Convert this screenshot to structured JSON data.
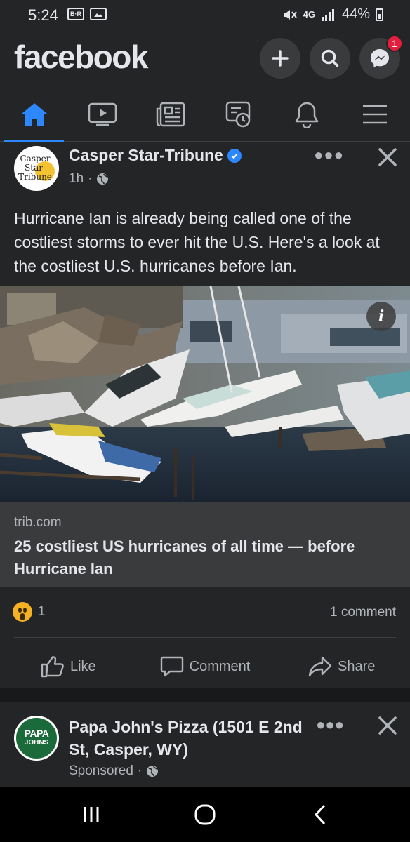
{
  "status_bar": {
    "time": "5:24",
    "left_icons": [
      "br-icon",
      "gallery-icon"
    ],
    "signal_text": "4G",
    "battery": "44%"
  },
  "header": {
    "logo": "facebook",
    "buttons": [
      "add-icon",
      "search-icon",
      "messenger-icon"
    ],
    "messenger_badge": "1"
  },
  "nav_tabs": [
    {
      "name": "home",
      "icon": "home-icon",
      "active": true
    },
    {
      "name": "watch",
      "icon": "video-icon",
      "active": false
    },
    {
      "name": "news",
      "icon": "news-icon",
      "active": false
    },
    {
      "name": "memories",
      "icon": "memories-icon",
      "active": false
    },
    {
      "name": "notifications",
      "icon": "bell-icon",
      "active": false
    },
    {
      "name": "menu",
      "icon": "menu-icon",
      "active": false
    }
  ],
  "post": {
    "page_name": "Casper Star-Tribune",
    "avatar_text": [
      "Casper",
      "Star",
      "Tribune"
    ],
    "time": "1h",
    "privacy_icon": "globe-icon",
    "text": "Hurricane Ian is already being called one of the costliest storms to ever hit the U.S. Here's a look at the costliest U.S. hurricanes before Ian.",
    "link": {
      "domain": "trib.com",
      "title": "25 costliest US hurricanes of all time — before Hurricane Ian"
    },
    "reaction_count": "1",
    "comments": "1 comment",
    "actions": {
      "like": "Like",
      "comment": "Comment",
      "share": "Share"
    }
  },
  "sponsored_post": {
    "page_name": "Papa John's Pizza (1501 E 2nd St, Casper, WY)",
    "avatar_text": [
      "PAPA",
      "JOHNS"
    ],
    "meta": "Sponsored"
  },
  "colors": {
    "background": "#242526",
    "accent": "#2d88ff",
    "badge": "#e41e3f"
  }
}
